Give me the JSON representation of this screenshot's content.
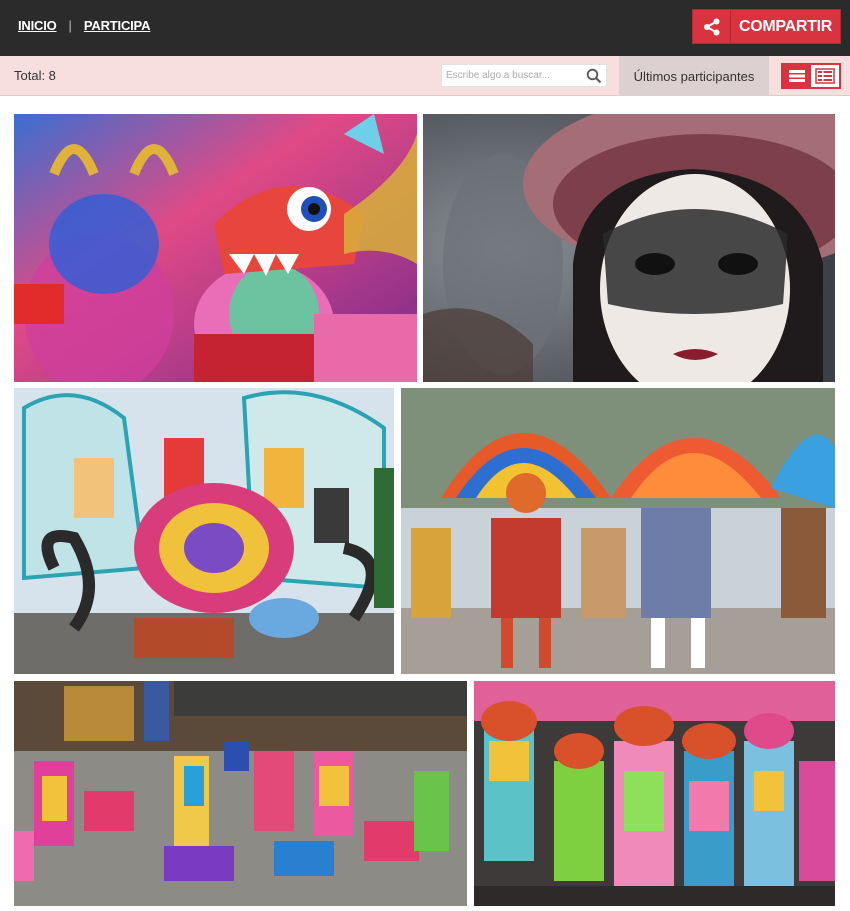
{
  "nav": {
    "home_label": "INICIO",
    "separator": "|",
    "participate_label": "PARTICIPA"
  },
  "share": {
    "label": "COMPARTIR",
    "icon": "share-icon"
  },
  "toolbar": {
    "total_text": "Total: 8",
    "search_placeholder": "Escribe algo a buscar...",
    "latest_label": "Últimos participantes",
    "view_options": [
      "grid-view-icon",
      "list-view-icon"
    ]
  },
  "colors": {
    "accent": "#d9333f",
    "topbar": "#2b2b2b",
    "toolbar": "#f7dfe0"
  },
  "gallery": {
    "photos": [
      {
        "subject": "carnival-devil-mask-photo"
      },
      {
        "subject": "venetian-lace-mask-photo"
      },
      {
        "subject": "carnival-float-photo"
      },
      {
        "subject": "feathered-dancers-photo"
      },
      {
        "subject": "clown-dancers-stage-photo"
      },
      {
        "subject": "costumed-dancers-photo"
      }
    ]
  }
}
